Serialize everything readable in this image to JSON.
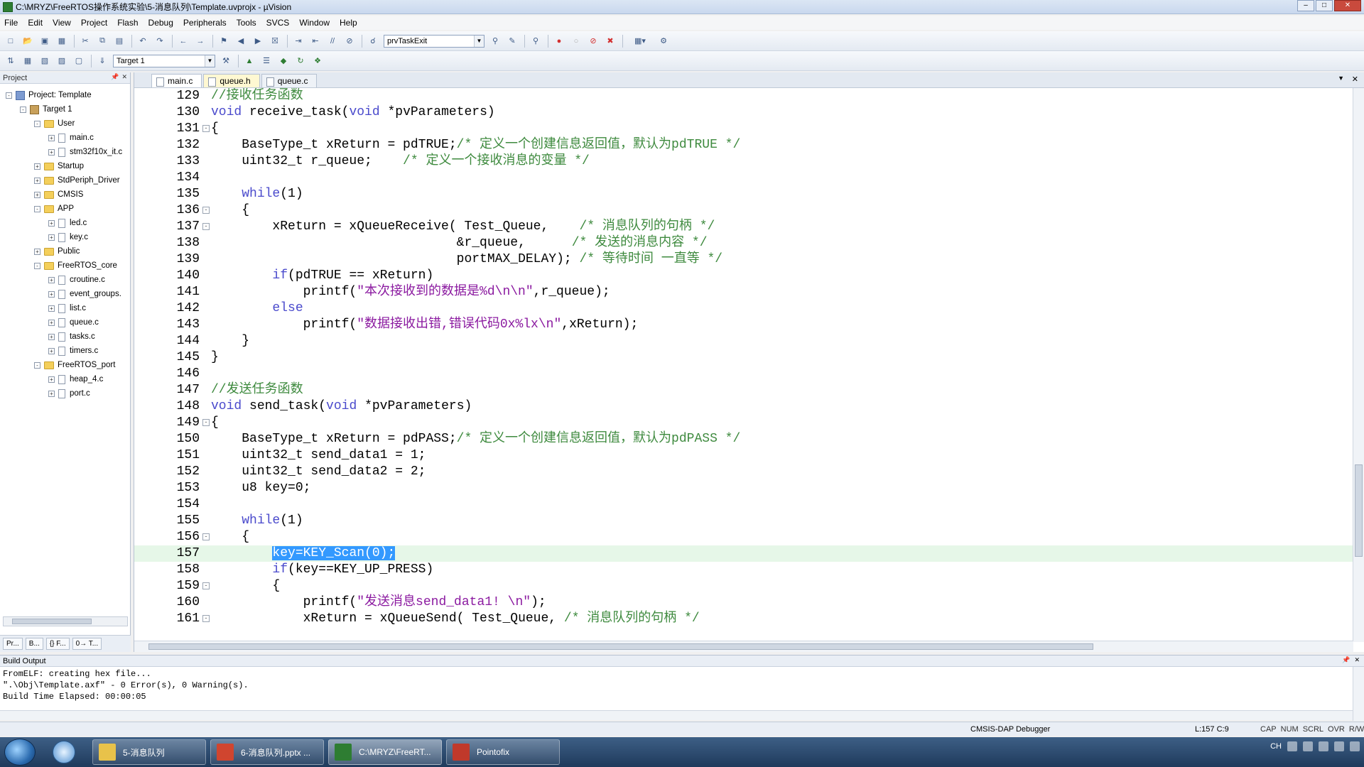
{
  "window": {
    "title": "C:\\MRYZ\\FreeRTOS操作系统实验\\5-消息队列\\Template.uvprojx - µVision"
  },
  "menu": [
    "File",
    "Edit",
    "View",
    "Project",
    "Flash",
    "Debug",
    "Peripherals",
    "Tools",
    "SVCS",
    "Window",
    "Help"
  ],
  "toolbar1": {
    "function_combo": "prvTaskExit"
  },
  "toolbar2": {
    "target_combo": "Target 1"
  },
  "project_panel": {
    "header": "Project",
    "tree": [
      {
        "label": "Project: Template",
        "type": "project",
        "level": 0,
        "expander": "-"
      },
      {
        "label": "Target 1",
        "type": "target",
        "level": 1,
        "expander": "-"
      },
      {
        "label": "User",
        "type": "folder",
        "level": 2,
        "expander": "-"
      },
      {
        "label": "main.c",
        "type": "file",
        "level": 3,
        "expander": "+"
      },
      {
        "label": "stm32f10x_it.c",
        "type": "file",
        "level": 3,
        "expander": "+"
      },
      {
        "label": "Startup",
        "type": "folder",
        "level": 2,
        "expander": "+"
      },
      {
        "label": "StdPeriph_Driver",
        "type": "folder",
        "level": 2,
        "expander": "+"
      },
      {
        "label": "CMSIS",
        "type": "folder",
        "level": 2,
        "expander": "+"
      },
      {
        "label": "APP",
        "type": "folder",
        "level": 2,
        "expander": "-"
      },
      {
        "label": "led.c",
        "type": "file",
        "level": 3,
        "expander": "+"
      },
      {
        "label": "key.c",
        "type": "file",
        "level": 3,
        "expander": "+"
      },
      {
        "label": "Public",
        "type": "folder",
        "level": 2,
        "expander": "+"
      },
      {
        "label": "FreeRTOS_core",
        "type": "folder",
        "level": 2,
        "expander": "-"
      },
      {
        "label": "croutine.c",
        "type": "file",
        "level": 3,
        "expander": "+"
      },
      {
        "label": "event_groups.",
        "type": "file",
        "level": 3,
        "expander": "+"
      },
      {
        "label": "list.c",
        "type": "file",
        "level": 3,
        "expander": "+"
      },
      {
        "label": "queue.c",
        "type": "file",
        "level": 3,
        "expander": "+"
      },
      {
        "label": "tasks.c",
        "type": "file",
        "level": 3,
        "expander": "+"
      },
      {
        "label": "timers.c",
        "type": "file",
        "level": 3,
        "expander": "+"
      },
      {
        "label": "FreeRTOS_port",
        "type": "folder",
        "level": 2,
        "expander": "-"
      },
      {
        "label": "heap_4.c",
        "type": "file",
        "level": 3,
        "expander": "+"
      },
      {
        "label": "port.c",
        "type": "file",
        "level": 3,
        "expander": "+"
      }
    ],
    "bottom_tabs": [
      "Pr...",
      "B...",
      "{} F...",
      "0→ T..."
    ]
  },
  "editor": {
    "tabs": [
      {
        "label": "main.c",
        "state": "current"
      },
      {
        "label": "queue.h",
        "state": "active"
      },
      {
        "label": "queue.c",
        "state": "normal"
      }
    ],
    "lines": [
      {
        "n": "129",
        "fold": "",
        "text": "//接收任务函数"
      },
      {
        "n": "130",
        "fold": "",
        "text": "void receive_task(void *pvParameters)"
      },
      {
        "n": "131",
        "fold": "-",
        "text": "{"
      },
      {
        "n": "132",
        "fold": "",
        "text": "    BaseType_t xReturn = pdTRUE;/* 定义一个创建信息返回值，默认为pdTRUE */"
      },
      {
        "n": "133",
        "fold": "",
        "text": "    uint32_t r_queue;    /* 定义一个接收消息的变量 */"
      },
      {
        "n": "134",
        "fold": "",
        "text": ""
      },
      {
        "n": "135",
        "fold": "",
        "text": "    while(1)"
      },
      {
        "n": "136",
        "fold": "-",
        "text": "    {"
      },
      {
        "n": "137",
        "fold": "-",
        "text": "        xReturn = xQueueReceive( Test_Queue,    /* 消息队列的句柄 */"
      },
      {
        "n": "138",
        "fold": "",
        "text": "                                &r_queue,      /* 发送的消息内容 */"
      },
      {
        "n": "139",
        "fold": "",
        "text": "                                portMAX_DELAY); /* 等待时间 一直等 */"
      },
      {
        "n": "140",
        "fold": "",
        "text": "        if(pdTRUE == xReturn)"
      },
      {
        "n": "141",
        "fold": "",
        "text": "            printf(\"本次接收到的数据是%d\\n\\n\",r_queue);"
      },
      {
        "n": "142",
        "fold": "",
        "text": "        else"
      },
      {
        "n": "143",
        "fold": "",
        "text": "            printf(\"数据接收出错,错误代码0x%lx\\n\",xReturn);"
      },
      {
        "n": "144",
        "fold": "",
        "text": "    }"
      },
      {
        "n": "145",
        "fold": "",
        "text": "}"
      },
      {
        "n": "146",
        "fold": "",
        "text": ""
      },
      {
        "n": "147",
        "fold": "",
        "text": "//发送任务函数"
      },
      {
        "n": "148",
        "fold": "",
        "text": "void send_task(void *pvParameters)"
      },
      {
        "n": "149",
        "fold": "-",
        "text": "{"
      },
      {
        "n": "150",
        "fold": "",
        "text": "    BaseType_t xReturn = pdPASS;/* 定义一个创建信息返回值，默认为pdPASS */"
      },
      {
        "n": "151",
        "fold": "",
        "text": "    uint32_t send_data1 = 1;"
      },
      {
        "n": "152",
        "fold": "",
        "text": "    uint32_t send_data2 = 2;"
      },
      {
        "n": "153",
        "fold": "",
        "text": "    u8 key=0;"
      },
      {
        "n": "154",
        "fold": "",
        "text": ""
      },
      {
        "n": "155",
        "fold": "",
        "text": "    while(1)"
      },
      {
        "n": "156",
        "fold": "-",
        "text": "    {"
      },
      {
        "n": "157",
        "fold": "",
        "text": "        key=KEY_Scan(0);",
        "highlight": true
      },
      {
        "n": "158",
        "fold": "",
        "text": "        if(key==KEY_UP_PRESS)"
      },
      {
        "n": "159",
        "fold": "-",
        "text": "        {"
      },
      {
        "n": "160",
        "fold": "",
        "text": "            printf(\"发送消息send_data1! \\n\");"
      },
      {
        "n": "161",
        "fold": "-",
        "text": "            xReturn = xQueueSend( Test_Queue, /* 消息队列的句柄 */"
      }
    ]
  },
  "build_output": {
    "header": "Build Output",
    "lines": [
      "FromELF: creating hex file...",
      "\".\\Obj\\Template.axf\" - 0 Error(s), 0 Warning(s).",
      "Build Time Elapsed:  00:00:05"
    ]
  },
  "statusbar": {
    "debugger": "CMSIS-DAP Debugger",
    "cursor": "L:157 C:9",
    "flags": [
      "CAP",
      "NUM",
      "SCRL",
      "OVR",
      "R/W"
    ]
  },
  "taskbar": {
    "buttons": [
      {
        "label": "5-消息队列",
        "color": "#e8c24a"
      },
      {
        "label": "6-消息队列.pptx ...",
        "color": "#d0452f"
      },
      {
        "label": "C:\\MRYZ\\FreeRT...",
        "color": "#2e7d32",
        "active": true
      },
      {
        "label": "Pointofix",
        "color": "#c0392b"
      }
    ],
    "tray_lang": "CH"
  }
}
